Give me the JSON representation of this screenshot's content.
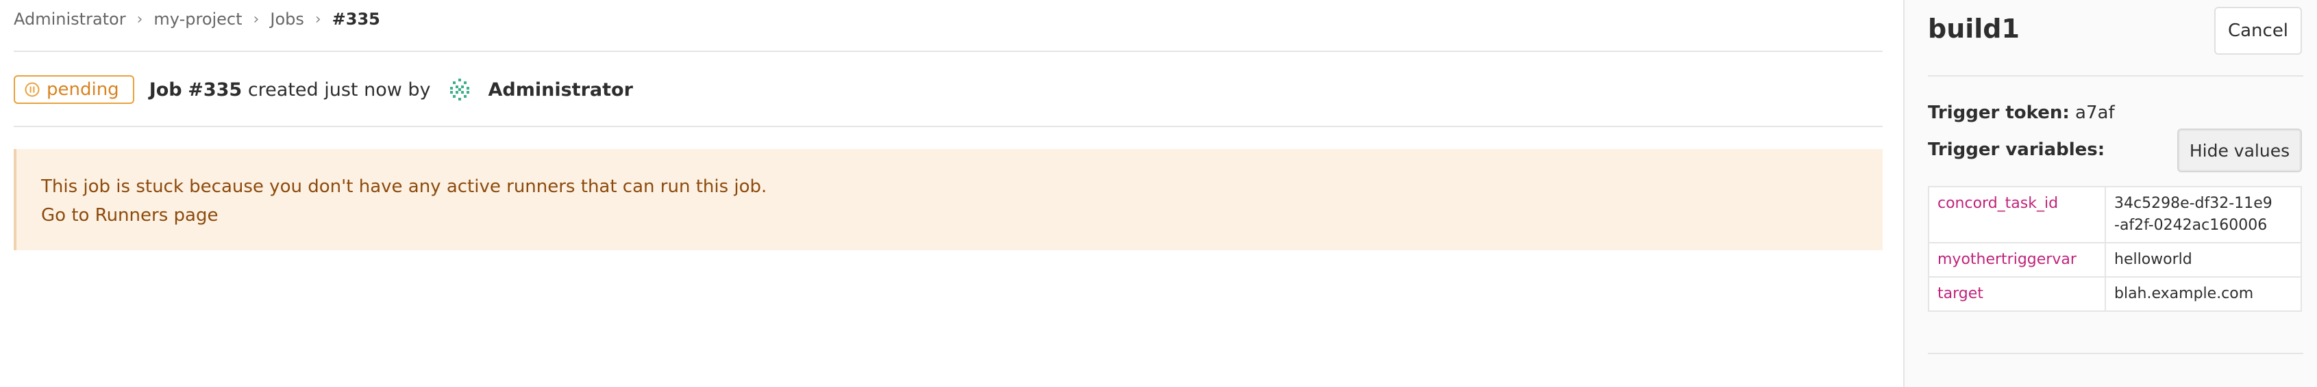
{
  "breadcrumb": {
    "items": [
      "Administrator",
      "my-project",
      "Jobs"
    ],
    "current": "#335",
    "separator": "›"
  },
  "job": {
    "status": "pending",
    "title_prefix": "Job",
    "id": "#335",
    "created_text": "created just now by",
    "author": "Administrator"
  },
  "alert": {
    "message": "This job is stuck because you don't have any active runners that can run this job.",
    "link_label": "Go to Runners page"
  },
  "sidebar": {
    "build_name": "build1",
    "cancel_label": "Cancel",
    "trigger_token_label": "Trigger token:",
    "trigger_token_value": "a7af",
    "trigger_variables_label": "Trigger variables:",
    "hide_values_label": "Hide values",
    "variables": [
      {
        "key": "concord_task_id",
        "value": "34c5298e-df32-11e9-af2f-0242ac160006"
      },
      {
        "key": "myothertriggervar",
        "value": "helloworld"
      },
      {
        "key": "target",
        "value": "blah.example.com"
      }
    ]
  },
  "colors": {
    "pending": "#e9a13b",
    "alert_bg": "#fdf1e3",
    "alert_text": "#8c4a0c",
    "var_key": "#c0237a"
  }
}
